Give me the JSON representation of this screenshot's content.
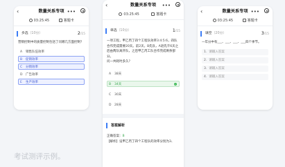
{
  "screens": [
    {
      "nav_back": "‹",
      "nav_title": "数量关系专项",
      "nav_more": "•••",
      "timer": "03:25:45",
      "answer_sheet": "答题卡",
      "q_type": "多选",
      "q_score": "（10分）",
      "progress_current": "2",
      "progress_total": "/15",
      "question": "营销控制中的质量控制包括了问哪几方面控制？",
      "options": [
        {
          "letter": "A",
          "text": "销售队伍效率"
        },
        {
          "letter": "B",
          "text": "促销效率"
        },
        {
          "letter": "C",
          "text": "分销效率"
        },
        {
          "letter": "D",
          "text": "广告效率"
        },
        {
          "letter": "E",
          "text": "生产效率"
        }
      ],
      "selected": [
        "B",
        "C",
        "E"
      ]
    },
    {
      "nav_back": "‹",
      "nav_title": "数量关系专项",
      "nav_more": "•••",
      "timer": "03:25:45",
      "answer_sheet": "答题卡",
      "q_type": "单选",
      "q_score": "（10分）",
      "progress_current": "1",
      "progress_total": "/15",
      "question_lines": [
        "一项工程，甲乙丙丁四个工程队效率3:4:5:6，四队",
        "合作完成需要20天。前2天，B先队，A退先干6天之",
        "后由两队离开队，之后甲乙丙工队合作完成剩余部分。",
        "问一共耗时多久？"
      ],
      "options": [
        {
          "letter": "A",
          "text": "38天"
        },
        {
          "letter": "B",
          "text": "34天"
        },
        {
          "letter": "C",
          "text": "30天"
        },
        {
          "letter": "D",
          "text": "28天"
        }
      ],
      "correct": "B",
      "analysis_title": "答案解析",
      "correct_answer_label": "正确答案：",
      "correct_answer": "B",
      "analysis_text": "【解析】设甲乙丙丁四个工程队的效率分别为3、"
    },
    {
      "nav_back": "‹",
      "nav_title": "数量关系专项",
      "nav_more": "•••",
      "timer": "03:25:45",
      "answer_sheet": "答题卡",
      "q_type": "填空",
      "q_score": "（20分）",
      "progress_current": "3",
      "progress_total": "/15",
      "question": "一年分中有___、___、___、___四个季节。",
      "blanks": [
        {
          "num": "1.",
          "placeholder": "请输入答案"
        },
        {
          "num": "2.",
          "placeholder": "请输入答案"
        },
        {
          "num": "3.",
          "placeholder": "请输入答案"
        },
        {
          "num": "4.",
          "placeholder": "请输入答案"
        }
      ]
    }
  ],
  "caption": "考试测评示例。",
  "colors": {
    "accent": "#3b7cf5",
    "selected_bg": "#eef1ff",
    "correct": "#3dba56"
  }
}
